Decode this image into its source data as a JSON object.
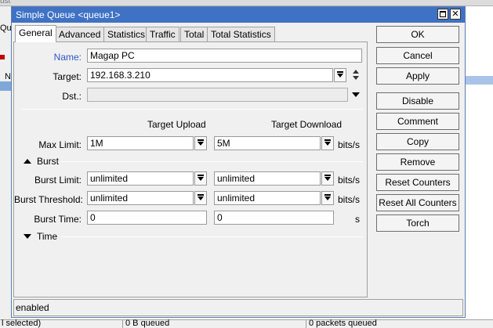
{
  "background": {
    "top_fragment": "ust",
    "left_fragment": "Qu",
    "left_col_header": "N",
    "status": {
      "selected": "l selected)",
      "bytes_queued": "0 B queued",
      "packets_queued": "0 packets queued"
    }
  },
  "dialog": {
    "title": "Simple Queue <queue1>",
    "maximize_glyph": "",
    "close_glyph": "✕",
    "tabs": [
      {
        "label": "General"
      },
      {
        "label": "Advanced"
      },
      {
        "label": "Statistics"
      },
      {
        "label": "Traffic"
      },
      {
        "label": "Total"
      },
      {
        "label": "Total Statistics"
      }
    ],
    "general": {
      "name_label": "Name:",
      "name_value": "Magap PC",
      "target_label": "Target:",
      "target_value": "192.168.3.210",
      "dst_label": "Dst.:",
      "dst_value": "",
      "col_upload": "Target Upload",
      "col_download": "Target Download",
      "max_limit_label": "Max Limit:",
      "max_limit_upload": "1M",
      "max_limit_download": "5M",
      "unit_bits": "bits/s",
      "burst_section": "Burst",
      "burst_limit_label": "Burst Limit:",
      "burst_limit_upload": "unlimited",
      "burst_limit_download": "unlimited",
      "burst_threshold_label": "Burst Threshold:",
      "burst_threshold_upload": "unlimited",
      "burst_threshold_download": "unlimited",
      "burst_time_label": "Burst Time:",
      "burst_time_upload": "0",
      "burst_time_download": "0",
      "unit_seconds": "s",
      "time_section": "Time"
    },
    "buttons": {
      "ok": "OK",
      "cancel": "Cancel",
      "apply": "Apply",
      "disable": "Disable",
      "comment": "Comment",
      "copy": "Copy",
      "remove": "Remove",
      "reset_counters": "Reset Counters",
      "reset_all_counters": "Reset All Counters",
      "torch": "Torch"
    },
    "status": "enabled"
  },
  "colors": {
    "titlebar": "#3f72c4",
    "label_highlight": "#2d56c8",
    "dialog_bg": "#f0f0f0"
  }
}
